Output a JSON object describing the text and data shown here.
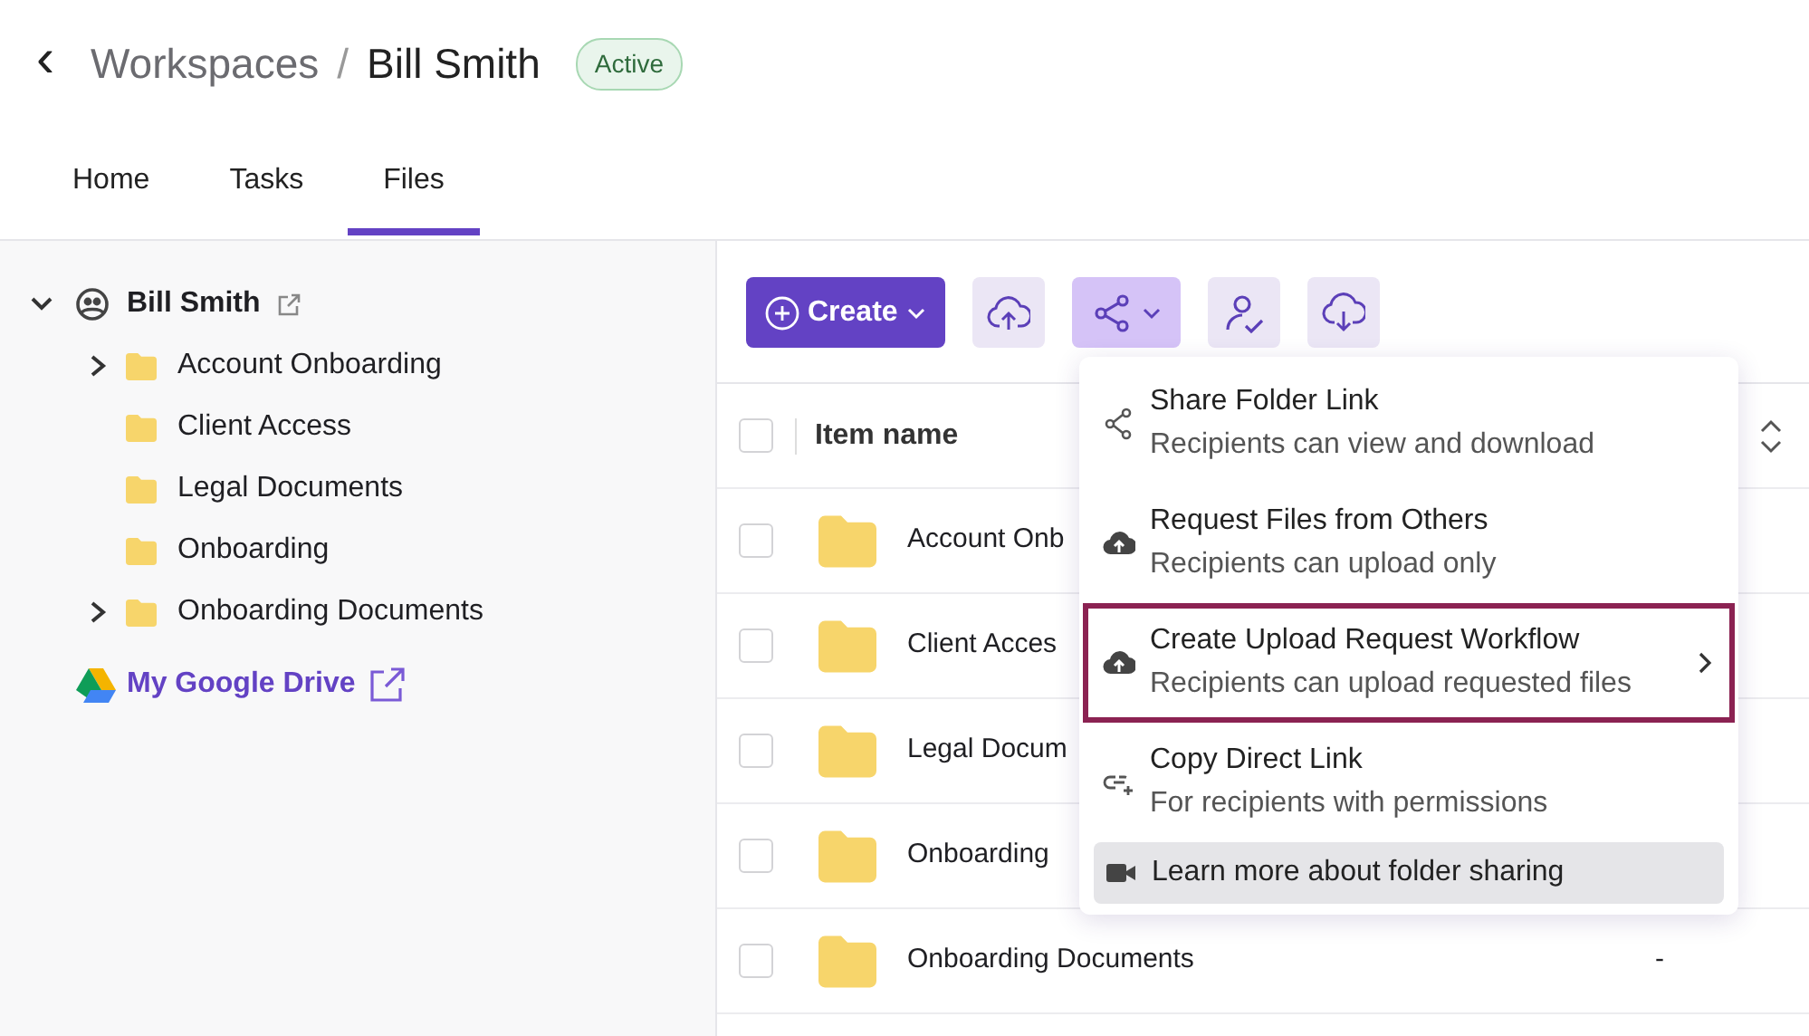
{
  "header": {
    "back": "‹",
    "breadcrumb_parent": "Workspaces",
    "separator": "/",
    "title": "Bill Smith",
    "status": "Active"
  },
  "tabs": [
    {
      "label": "Home",
      "selected": false
    },
    {
      "label": "Tasks",
      "selected": false
    },
    {
      "label": "Files",
      "selected": true
    }
  ],
  "sidebar": {
    "root": {
      "label": "Bill Smith",
      "expanded": true,
      "children": [
        {
          "label": "Account Onboarding",
          "expanded": false
        },
        {
          "label": "Client Access"
        },
        {
          "label": "Legal Documents"
        },
        {
          "label": "Onboarding"
        },
        {
          "label": "Onboarding Documents",
          "expanded": false
        }
      ]
    },
    "drive_link": "My Google Drive"
  },
  "toolbar": [
    {
      "kind": "create",
      "label": "Create"
    },
    {
      "kind": "upload",
      "active": false
    },
    {
      "kind": "share",
      "active": true
    },
    {
      "kind": "assign",
      "active": false
    },
    {
      "kind": "download",
      "active": false
    }
  ],
  "table": {
    "select_all_checked": false,
    "columns": [
      {
        "label": "Item name"
      }
    ],
    "rows": [
      {
        "name": "Account Onb",
        "checked": false
      },
      {
        "name": "Client Acces",
        "checked": false
      },
      {
        "name": "Legal Docum",
        "checked": false
      },
      {
        "name": "Onboarding",
        "checked": false
      },
      {
        "name": "Onboarding Documents",
        "column_2": "-",
        "checked": false
      }
    ]
  },
  "share_menu": [
    {
      "kind": "share",
      "title": "Share Folder Link",
      "subtitle": "Recipients can view and download",
      "outlined": false,
      "highlighted": false,
      "submenu": false
    },
    {
      "kind": "cloud",
      "title": "Request Files from Others",
      "subtitle": "Recipients can upload only",
      "outlined": false,
      "highlighted": false,
      "submenu": false
    },
    {
      "kind": "cloud",
      "title": "Create Upload Request Workflow",
      "subtitle": "Recipients can upload requested files",
      "outlined": true,
      "highlighted": false,
      "submenu": true
    },
    {
      "kind": "link",
      "title": "Copy Direct Link",
      "subtitle": "For recipients with permissions",
      "outlined": false,
      "highlighted": false,
      "submenu": false
    },
    {
      "kind": "video",
      "title": "Learn more about folder sharing",
      "outlined": false,
      "highlighted": true,
      "submenu": false
    }
  ]
}
